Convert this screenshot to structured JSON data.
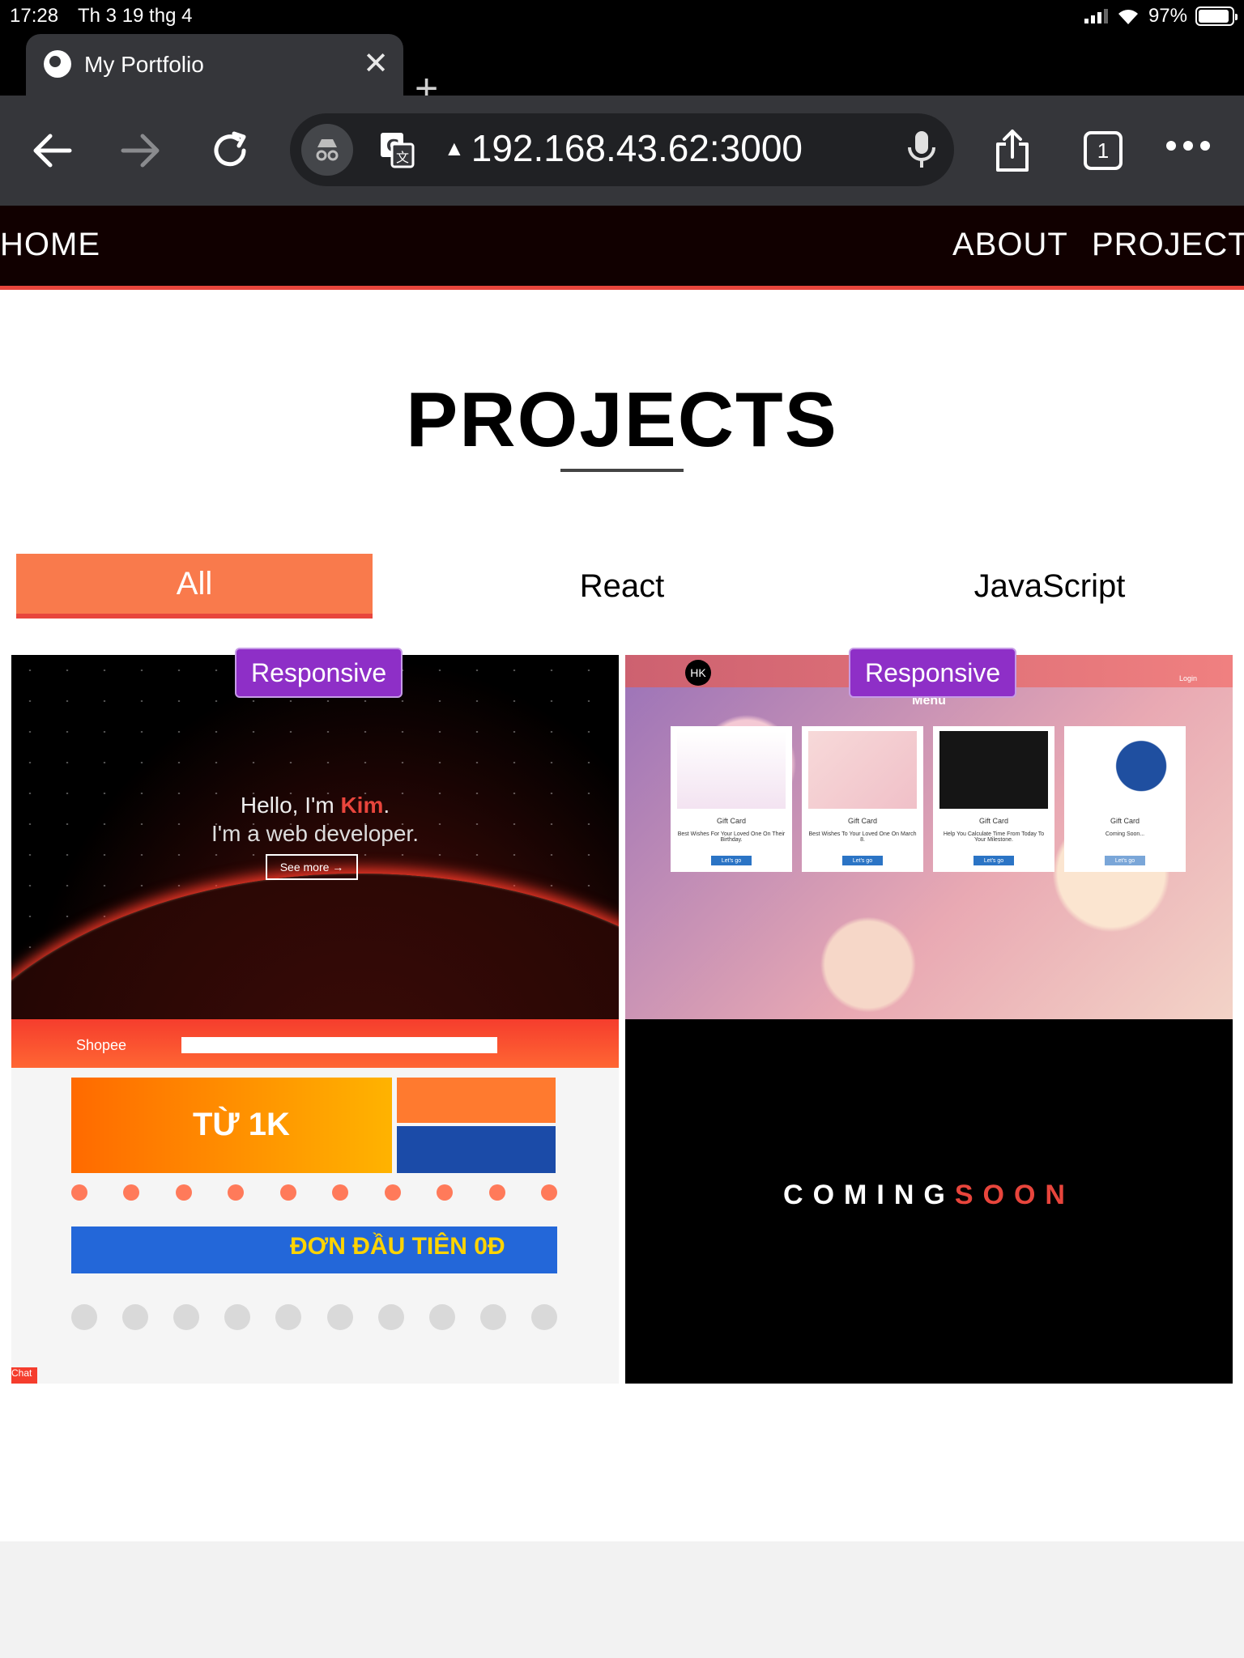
{
  "status": {
    "time": "17:28",
    "date": "Th 3 19 thg 4",
    "battery": "97%"
  },
  "browser": {
    "tab_title": "My Portfolio",
    "tab_count": "1",
    "url": "192.168.43.62:3000"
  },
  "site": {
    "nav": {
      "home": "HOME",
      "about": "ABOUT",
      "projects": "PROJECTS"
    },
    "heading": "PROJECTS",
    "filters": [
      "All",
      "React",
      "JavaScript"
    ],
    "active_filter": "All",
    "projects": [
      {
        "badge": "Responsive",
        "hero_line1_prefix": "Hello, I'm ",
        "hero_name": "Kim",
        "hero_line1_suffix": ".",
        "hero_line2": "I'm a web developer.",
        "hero_button": "See more",
        "shop_logo": "Shopee",
        "shop_banner": "TỪ 1K",
        "shop_promo": "ĐƠN ĐẦU TIÊN 0Đ",
        "chat": "Chat"
      },
      {
        "badge": "Responsive",
        "logo": "HK",
        "menu": "Menu",
        "login": "Login",
        "gift_cards": [
          {
            "title": "Gift Card",
            "desc": "Best Wishes For Your Loved One On Their Birthday.",
            "button": "Let's go"
          },
          {
            "title": "Gift Card",
            "desc": "Best Wishes To Your Loved One On March 8.",
            "button": "Let's go"
          },
          {
            "title": "Gift Card",
            "desc": "Help You Calculate Time From Today To Your Milestone.",
            "button": "Let's go"
          },
          {
            "title": "Gift Card",
            "desc": "Coming Soon...",
            "button": "Let's go"
          }
        ],
        "coming_white": "COMING",
        "coming_red": "SOON"
      }
    ]
  },
  "colors": {
    "accent": "#f97a4c",
    "nav_border": "#e8453c",
    "badge": "#8e2fc7",
    "nav_bg": "#110000"
  }
}
